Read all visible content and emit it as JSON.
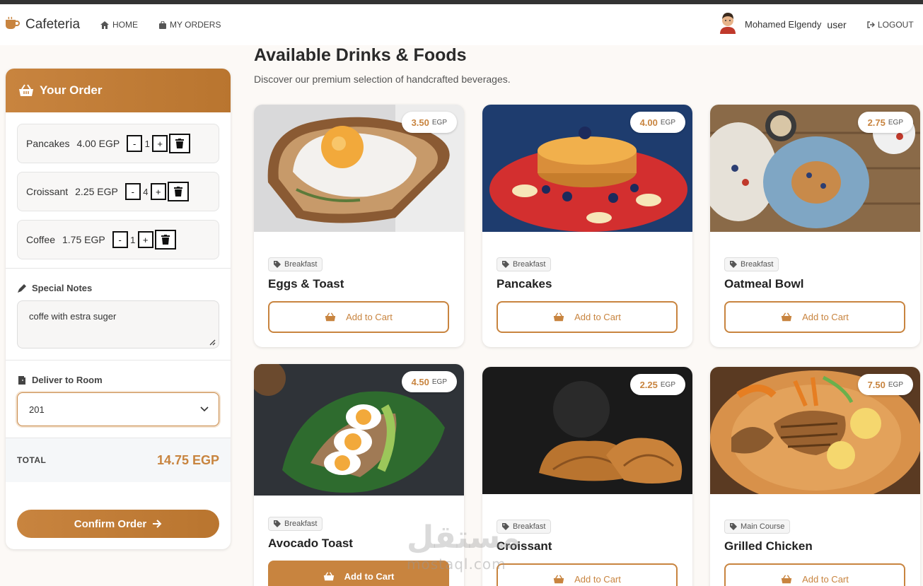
{
  "brand": {
    "name": "Cafeteria",
    "icon": "coffee-cup-icon",
    "accent": "#c8843f"
  },
  "nav": {
    "home": "HOME",
    "orders": "MY ORDERS",
    "user_name": "Mohamed Elgendy",
    "user_role": "user",
    "logout": "LOGOUT"
  },
  "sidebar": {
    "title": "Your Order",
    "items": [
      {
        "name": "Pancakes",
        "price": "4.00 EGP",
        "qty": "1"
      },
      {
        "name": "Croissant",
        "price": "2.25 EGP",
        "qty": "4"
      },
      {
        "name": "Coffee",
        "price": "1.75 EGP",
        "qty": "1"
      }
    ],
    "minus": "-",
    "plus": "+",
    "notes_label": "Special Notes",
    "notes_value": "coffe with estra suger",
    "room_label": "Deliver to Room",
    "room_value": "201",
    "total_label": "TOTAL",
    "total_value": "14.75 EGP",
    "confirm": "Confirm Order"
  },
  "main": {
    "title": "Available Drinks & Foods",
    "subtitle": "Discover our premium selection of handcrafted beverages.",
    "currency": "EGP",
    "add_label": "Add to Cart",
    "products": [
      {
        "name": "Eggs & Toast",
        "price": "3.50",
        "category": "Breakfast"
      },
      {
        "name": "Pancakes",
        "price": "4.00",
        "category": "Breakfast"
      },
      {
        "name": "Oatmeal Bowl",
        "price": "2.75",
        "category": "Breakfast"
      },
      {
        "name": "Avocado Toast",
        "price": "4.50",
        "category": "Breakfast"
      },
      {
        "name": "Croissant",
        "price": "2.25",
        "category": "Breakfast"
      },
      {
        "name": "Grilled Chicken",
        "price": "7.50",
        "category": "Main Course"
      }
    ]
  },
  "watermark": {
    "arabic": "مستقل",
    "latin": "mostaql.com"
  }
}
